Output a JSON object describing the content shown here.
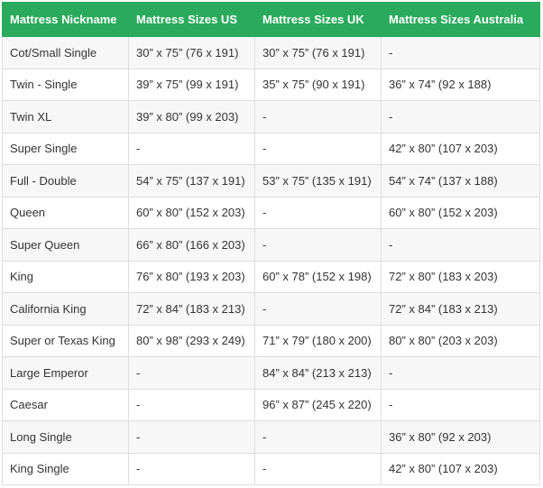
{
  "table": {
    "headers": [
      "Mattress Nickname",
      "Mattress Sizes US",
      "Mattress Sizes UK",
      "Mattress Sizes Australia"
    ],
    "rows": [
      [
        "Cot/Small Single",
        "30” x 75” (76 x 191)",
        "30” x 75” (76 x 191)",
        "-"
      ],
      [
        "Twin - Single",
        "39” x 75” (99 x 191)",
        "35” x 75” (90 x 191)",
        "36” x 74” (92 x 188)"
      ],
      [
        "Twin XL",
        "39” x 80” (99 x 203)",
        "-",
        "-"
      ],
      [
        "Super Single",
        "-",
        "-",
        "42” x 80” (107 x 203)"
      ],
      [
        "Full - Double",
        "54” x 75” (137 x 191)",
        "53” x 75” (135 x 191)",
        "54” x 74” (137 x 188)"
      ],
      [
        "Queen",
        "60” x 80” (152 x 203)",
        "-",
        "60” x 80” (152 x 203)"
      ],
      [
        "Super Queen",
        "66” x 80” (166 x 203)",
        "-",
        "-"
      ],
      [
        "King",
        "76” x 80” (193 x 203)",
        "60” x 78” (152 x 198)",
        "72” x 80” (183 x 203)"
      ],
      [
        "California King",
        "72” x 84” (183 x 213)",
        "-",
        "72” x 84” (183 x 213)"
      ],
      [
        "Super or Texas King",
        "80” x 98” (293 x 249)",
        "71” x 79” (180 x 200)",
        "80” x 80” (203 x 203)"
      ],
      [
        "Large Emperor",
        "-",
        "84” x 84” (213 x 213)",
        "-"
      ],
      [
        "Caesar",
        "-",
        "96” x 87” (245 x 220)",
        "-"
      ],
      [
        "Long Single",
        "-",
        "-",
        "36” x 80” (92 x 203)"
      ],
      [
        "King Single",
        "-",
        "-",
        "42” x 80” (107 x 203)"
      ]
    ]
  },
  "colors": {
    "header_bg": "#2aaa5c",
    "header_text": "#ffffff",
    "row_alt_bg": "#f7f7f7",
    "border": "#dddddd"
  }
}
